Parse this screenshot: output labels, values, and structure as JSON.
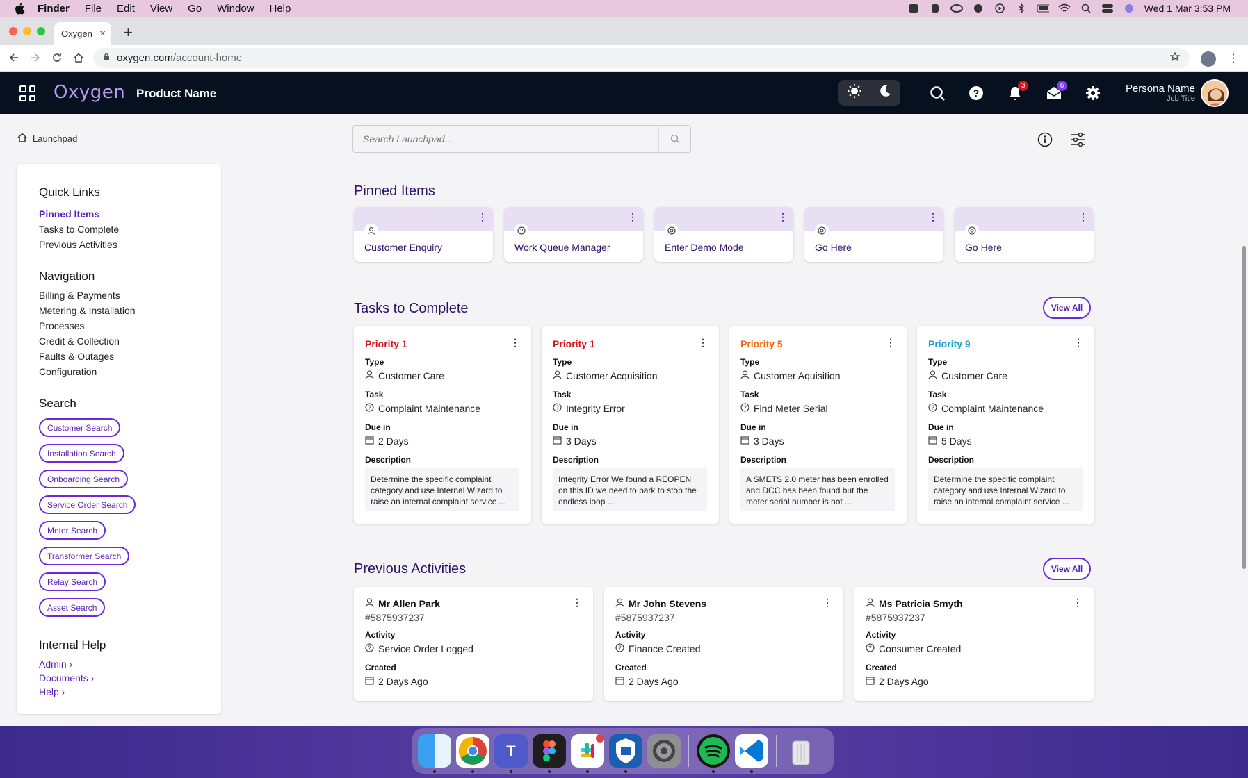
{
  "menubar": {
    "items": [
      "Finder",
      "File",
      "Edit",
      "View",
      "Go",
      "Window",
      "Help"
    ],
    "datetime": "Wed 1 Mar  3:53 PM"
  },
  "browser": {
    "tab_title": "Oxygen",
    "url_domain": "oxygen.com",
    "url_path": "/account-home"
  },
  "header": {
    "logo": "Oxygen",
    "product": "Product Name",
    "notifications_count": "3",
    "messages_count": "6",
    "persona_name": "Persona Name",
    "persona_title": "Job Title"
  },
  "breadcrumb": "Launchpad",
  "search": {
    "placeholder": "Search Launchpad..."
  },
  "sidebar": {
    "quick_links_title": "Quick Links",
    "quick_links": [
      "Pinned Items",
      "Tasks to Complete",
      "Previous Activities"
    ],
    "navigation_title": "Navigation",
    "navigation": [
      "Billing & Payments",
      "Metering & Installation",
      "Processes",
      "Credit & Collection",
      "Faults & Outages",
      "Configuration"
    ],
    "search_title": "Search",
    "searches": [
      "Customer Search",
      "Installation Search",
      "Onboarding Search",
      "Service Order Search",
      "Meter Search",
      "Transformer Search",
      "Relay Search",
      "Asset Search"
    ],
    "help_title": "Internal Help",
    "help_links": [
      "Admin",
      "Documents",
      "Help"
    ]
  },
  "pinned": {
    "title": "Pinned Items",
    "items": [
      "Customer Enquiry",
      "Work Queue Manager",
      "Enter Demo Mode",
      "Go Here",
      "Go Here"
    ]
  },
  "tasks": {
    "title": "Tasks to Complete",
    "view_all": "View All",
    "labels": {
      "type": "Type",
      "task": "Task",
      "due": "Due in",
      "description": "Description"
    },
    "colors": {
      "p1": "#d0161b",
      "p5": "#f26a0e",
      "p9": "#1a9fd0"
    },
    "items": [
      {
        "priority": "Priority 1",
        "type": "Customer Care",
        "task": "Complaint Maintenance",
        "due": "2 Days",
        "description": "Determine the specific complaint category and use Internal Wizard to raise an internal complaint service ..."
      },
      {
        "priority": "Priority 1",
        "type": "Customer Acquisition",
        "task": "Integrity Error",
        "due": "3 Days",
        "description": "Integrity Error We found a REOPEN on this ID we need to park to stop the endless loop ..."
      },
      {
        "priority": "Priority 5",
        "type": "Customer Aquisition",
        "task": "Find Meter Serial",
        "due": "3 Days",
        "description": "A SMETS 2.0 meter has been enrolled and DCC has been found but the meter serial number is not ..."
      },
      {
        "priority": "Priority 9",
        "type": "Customer Care",
        "task": "Complaint Maintenance",
        "due": "5 Days",
        "description": "Determine the specific complaint category and use Internal Wizard to raise an internal complaint service ..."
      }
    ]
  },
  "activities": {
    "title": "Previous Activities",
    "view_all": "View All",
    "labels": {
      "activity": "Activity",
      "created": "Created"
    },
    "items": [
      {
        "name": "Mr Allen Park",
        "id": "#5875937237",
        "activity": "Service Order Logged",
        "created": "2 Days Ago"
      },
      {
        "name": "Mr John Stevens",
        "id": "#5875937237",
        "activity": "Finance Created",
        "created": "2 Days Ago"
      },
      {
        "name": "Ms Patricia Smyth",
        "id": "#5875937237",
        "activity": "Consumer Created",
        "created": "2 Days Ago"
      }
    ]
  },
  "dock": {
    "apps": [
      "finder-icon",
      "chrome-icon",
      "teams-icon",
      "figma-icon",
      "slack-icon",
      "shield-app-icon",
      "settings-app-icon",
      "spotify-icon",
      "vscode-icon",
      "trash-icon"
    ]
  },
  "accent": "#5b21b6"
}
